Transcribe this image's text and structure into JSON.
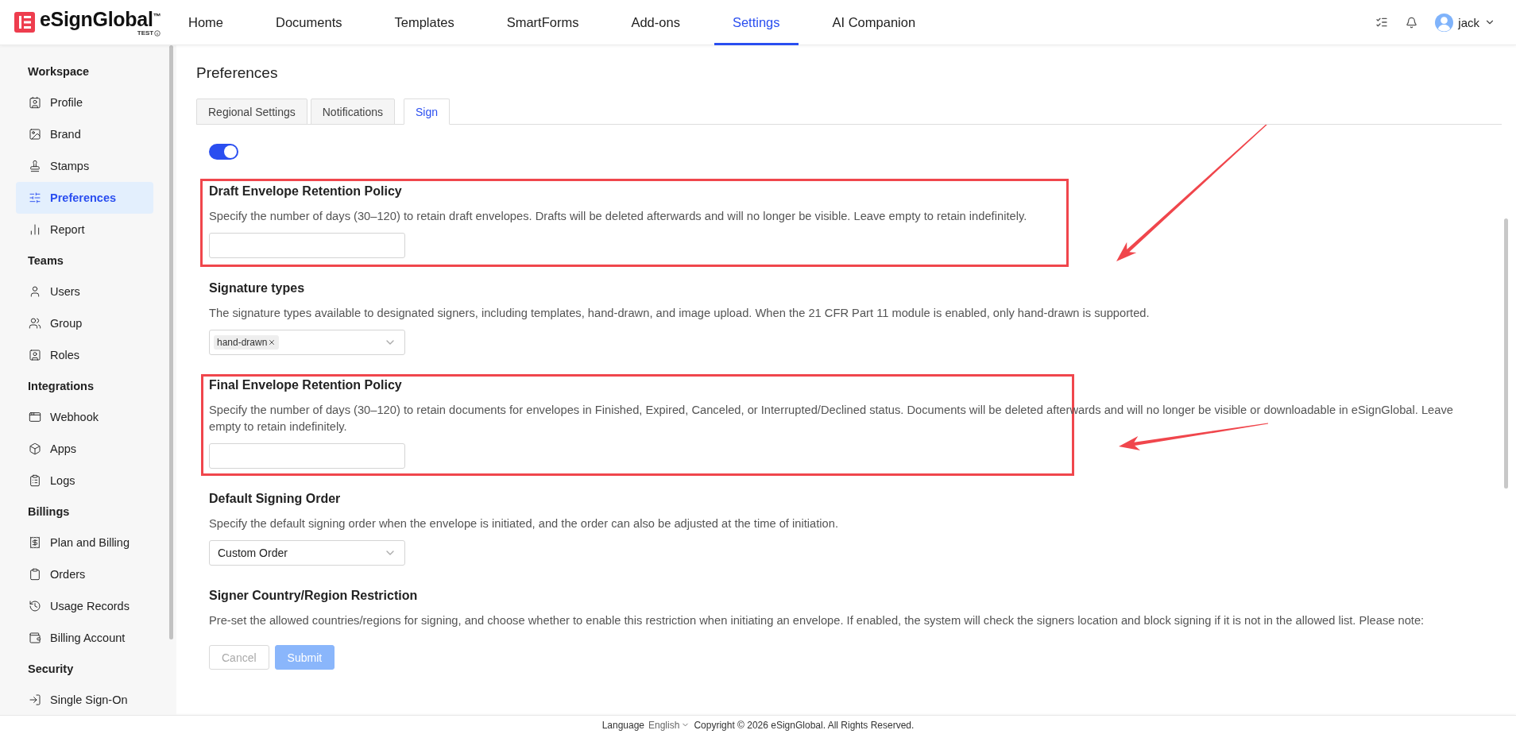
{
  "header": {
    "logo": {
      "name": "eSignGlobal",
      "mark": "™",
      "badge": "TEST"
    },
    "nav": [
      {
        "label": "Home",
        "selected": false
      },
      {
        "label": "Documents",
        "selected": false
      },
      {
        "label": "Templates",
        "selected": false
      },
      {
        "label": "SmartForms",
        "selected": false
      },
      {
        "label": "Add-ons",
        "selected": false
      },
      {
        "label": "Settings",
        "selected": true
      },
      {
        "label": "AI Companion",
        "selected": false
      }
    ],
    "user": {
      "name": "jack"
    }
  },
  "sidebar": {
    "groups": [
      {
        "title": "Workspace",
        "items": [
          {
            "label": "Profile",
            "selected": false
          },
          {
            "label": "Brand",
            "selected": false
          },
          {
            "label": "Stamps",
            "selected": false
          },
          {
            "label": "Preferences",
            "selected": true
          },
          {
            "label": "Report",
            "selected": false
          }
        ]
      },
      {
        "title": "Teams",
        "items": [
          {
            "label": "Users",
            "selected": false
          },
          {
            "label": "Group",
            "selected": false
          },
          {
            "label": "Roles",
            "selected": false
          }
        ]
      },
      {
        "title": "Integrations",
        "items": [
          {
            "label": "Webhook",
            "selected": false
          },
          {
            "label": "Apps",
            "selected": false
          },
          {
            "label": "Logs",
            "selected": false
          }
        ]
      },
      {
        "title": "Billings",
        "items": [
          {
            "label": "Plan and Billing",
            "selected": false
          },
          {
            "label": "Orders",
            "selected": false
          },
          {
            "label": "Usage Records",
            "selected": false
          },
          {
            "label": "Billing Account",
            "selected": false
          }
        ]
      },
      {
        "title": "Security",
        "items": [
          {
            "label": "Single Sign-On",
            "selected": false
          }
        ]
      }
    ]
  },
  "page": {
    "title": "Preferences",
    "tabs": [
      {
        "label": "Regional Settings",
        "selected": false
      },
      {
        "label": "Notifications",
        "selected": false
      },
      {
        "label": "Sign",
        "selected": true
      }
    ],
    "toggle": {
      "on": true
    },
    "sections": [
      {
        "kind": "input",
        "title": "Draft Envelope Retention Policy",
        "description": "Specify the number of days (30–120) to retain draft envelopes. Drafts will be deleted afterwards and will no longer be visible. Leave empty to retain indefinitely.",
        "annotated": true
      },
      {
        "kind": "tags",
        "title": "Signature types",
        "description": "The signature types available to designated signers, including templates, hand-drawn, and image upload. When the 21 CFR Part 11 module is enabled, only hand-drawn is supported.",
        "tags": [
          "hand-drawn"
        ],
        "annotated": false
      },
      {
        "kind": "input",
        "title": "Final Envelope Retention Policy",
        "description": "Specify the number of days (30–120) to retain documents for envelopes in Finished, Expired, Canceled, or Interrupted/Declined status. Documents will be deleted afterwards and will no longer be visible or downloadable in eSignGlobal. Leave empty to retain indefinitely.",
        "annotated": true
      },
      {
        "kind": "select",
        "title": "Default Signing Order",
        "description": "Specify the default signing order when the envelope is initiated, and the order can also be adjusted at the time of initiation.",
        "value": "Custom Order",
        "annotated": false
      },
      {
        "kind": "text",
        "title": "Signer Country/Region Restriction",
        "description": "Pre-set the allowed countries/regions for signing, and choose whether to enable this restriction when initiating an envelope. If enabled, the system will check the signers location and block signing if it is not in the allowed list. Please note:",
        "annotated": false
      }
    ],
    "buttons": [
      {
        "label": "Cancel",
        "kind": "secondary",
        "disabled": true
      },
      {
        "label": "Submit",
        "kind": "primary",
        "disabled": true
      }
    ]
  },
  "footer": {
    "language_label": "Language",
    "language": "English",
    "copyright": "Copyright © 2026 eSignGlobal. All Rights Reserved."
  }
}
